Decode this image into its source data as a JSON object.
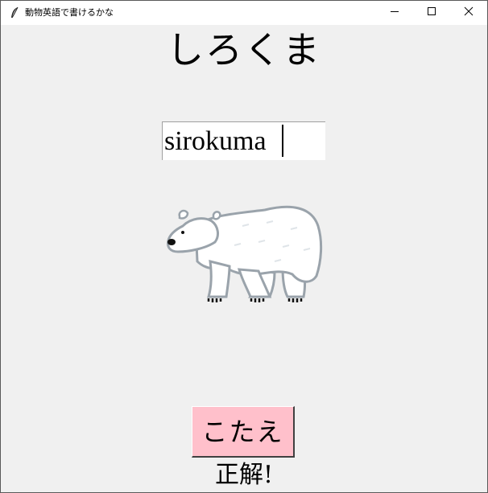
{
  "window": {
    "title": "動物英語で書けるかな"
  },
  "question": {
    "kana": "しろくま"
  },
  "entry": {
    "value": "sirokuma"
  },
  "image": {
    "animal": "polar-bear"
  },
  "answer_button": {
    "label": "こたえ",
    "background": "#ffc0cb"
  },
  "result": {
    "text": "正解!"
  }
}
